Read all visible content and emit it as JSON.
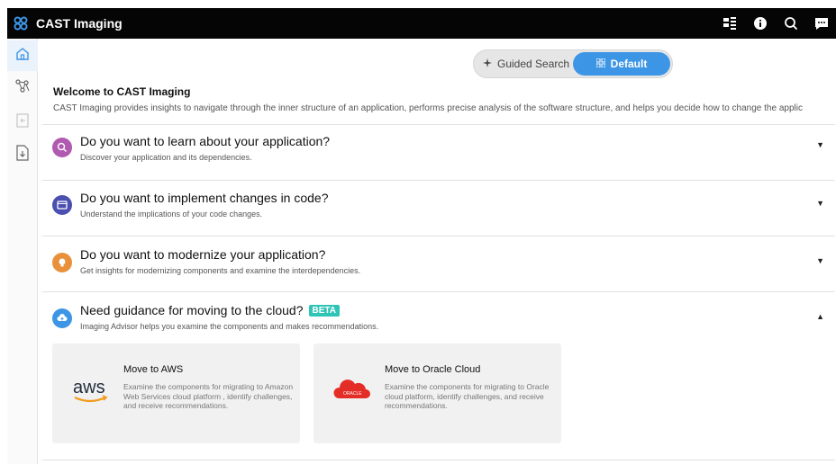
{
  "app": {
    "title": "CAST Imaging"
  },
  "colors": {
    "accent": "#3d95e6",
    "beta": "#2ec4b6",
    "topbar": "#050505"
  },
  "topbar_icons": [
    "grid-layout-icon",
    "info-icon",
    "search-icon",
    "chat-icon"
  ],
  "sidebar": {
    "items": [
      {
        "icon": "home-icon",
        "active": true
      },
      {
        "icon": "graph-icon",
        "active": false
      },
      {
        "icon": "document-compare-icon",
        "active": false
      },
      {
        "icon": "document-download-icon",
        "active": false
      }
    ]
  },
  "mode_toggle": {
    "options": [
      {
        "label": "Guided Search",
        "icon": "sparkle-icon",
        "selected": false
      },
      {
        "label": "Default",
        "icon": "grid-icon",
        "selected": true
      }
    ]
  },
  "welcome": {
    "title": "Welcome to CAST Imaging",
    "description": "CAST Imaging provides insights to navigate through the inner structure of an application, performs precise analysis of the software structure, and helps you decide how to change the applic"
  },
  "sections": [
    {
      "title": "Do you want to learn about your application?",
      "description": "Discover your application and its dependencies.",
      "icon": "discover-icon",
      "icon_color": "#b05ab0",
      "expanded": false
    },
    {
      "title": "Do you want to implement changes in code?",
      "description": "Understand the implications of your code changes.",
      "icon": "code-window-icon",
      "icon_color": "#4a4fb0",
      "expanded": false
    },
    {
      "title": "Do you want to modernize your application?",
      "description": "Get insights for modernizing components and examine the interdependencies.",
      "icon": "lightbulb-icon",
      "icon_color": "#e8913a",
      "expanded": false
    },
    {
      "title": "Need guidance for moving to the cloud?",
      "badge": "BETA",
      "description": "Imaging Advisor helps you examine the components and makes recommendations.",
      "icon": "cloud-upload-icon",
      "icon_color": "#3d95e6",
      "expanded": true
    }
  ],
  "cloud_cards": [
    {
      "logo_text": "aws",
      "title": "Move to AWS",
      "description": "Examine the components for migrating to Amazon Web Services cloud platform , identify challenges, and receive recommendations."
    },
    {
      "logo_text": "ORACLE",
      "title": "Move to Oracle Cloud",
      "description": "Examine the components for migrating to Oracle cloud platform, identify challenges, and receive recommendations."
    }
  ]
}
